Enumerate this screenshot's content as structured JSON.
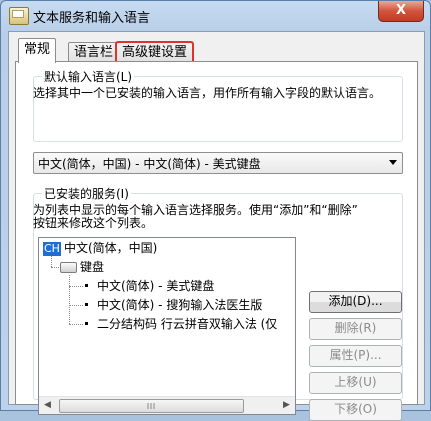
{
  "window": {
    "title": "文本服务和输入语言",
    "close_glyph": "X"
  },
  "tabs": [
    {
      "label": "常规",
      "active": true
    },
    {
      "label": "语言栏",
      "active": false
    },
    {
      "label": "高级键设置",
      "active": false,
      "highlighted": true
    }
  ],
  "default_lang": {
    "title": "默认输入语言(L)",
    "description": "选择其中一个已安装的输入语言，用作所有输入字段的默认语言。",
    "selected": "中文(简体，中国) - 中文(简体) - 美式键盘"
  },
  "installed": {
    "title": "已安装的服务(I)",
    "description_line1": "为列表中显示的每个输入语言选择服务。使用“添加”和“删除”",
    "description_line2": "按钮来修改这个列表。",
    "tree": {
      "lang_badge": "CH",
      "lang_label": "中文(简体，中国)",
      "keyboard_label": "键盘",
      "items": [
        "中文(简体) - 美式键盘",
        "中文(简体) - 搜狗输入法医生版",
        "二分结构码 行云拼音双输入法 (仅"
      ]
    },
    "scroll": {
      "left": "◀",
      "right": "▶"
    },
    "buttons": {
      "add": "添加(D)...",
      "remove": "删除(R)",
      "properties": "属性(P)...",
      "move_up": "上移(U)",
      "move_down": "下移(O)"
    }
  },
  "colors": {
    "highlight_outline": "#e0322b",
    "lang_badge_bg": "#1c6fd6"
  }
}
